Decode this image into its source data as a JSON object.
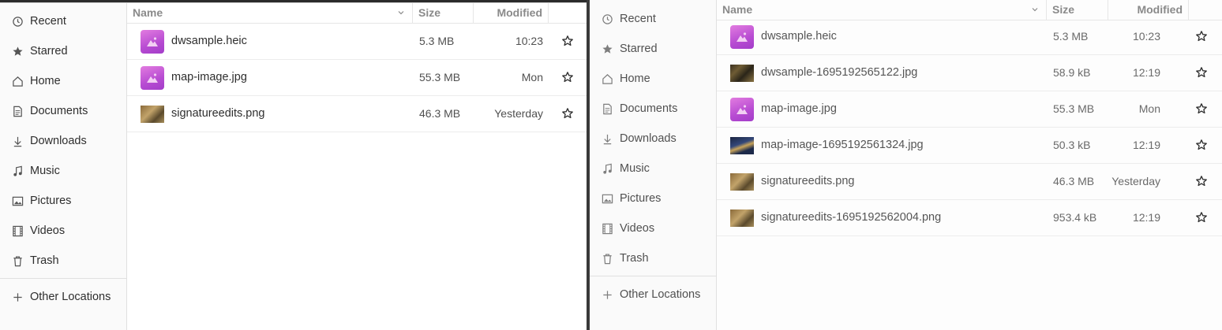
{
  "sidebar": {
    "items": [
      {
        "label": "Recent",
        "icon": "clock-icon"
      },
      {
        "label": "Starred",
        "icon": "star-filled-icon"
      },
      {
        "label": "Home",
        "icon": "home-icon"
      },
      {
        "label": "Documents",
        "icon": "document-icon"
      },
      {
        "label": "Downloads",
        "icon": "download-icon"
      },
      {
        "label": "Music",
        "icon": "music-icon"
      },
      {
        "label": "Pictures",
        "icon": "picture-icon"
      },
      {
        "label": "Videos",
        "icon": "video-icon"
      },
      {
        "label": "Trash",
        "icon": "trash-icon"
      }
    ],
    "other_locations": "Other Locations"
  },
  "columns": {
    "name": "Name",
    "size": "Size",
    "modified": "Modified"
  },
  "left_window": {
    "files": [
      {
        "name": "dwsample.heic",
        "size": "5.3 MB",
        "modified": "10:23",
        "thumb": "generic-image"
      },
      {
        "name": "map-image.jpg",
        "size": "55.3 MB",
        "modified": "Mon",
        "thumb": "generic-image"
      },
      {
        "name": "signatureedits.png",
        "size": "46.3 MB",
        "modified": "Yesterday",
        "thumb": "photo-brown"
      }
    ]
  },
  "right_window": {
    "files": [
      {
        "name": "dwsample.heic",
        "size": "5.3 MB",
        "modified": "10:23",
        "thumb": "generic-image"
      },
      {
        "name": "dwsample-1695192565122.jpg",
        "size": "58.9 kB",
        "modified": "12:19",
        "thumb": "photo-dark"
      },
      {
        "name": "map-image.jpg",
        "size": "55.3 MB",
        "modified": "Mon",
        "thumb": "generic-image"
      },
      {
        "name": "map-image-1695192561324.jpg",
        "size": "50.3 kB",
        "modified": "12:19",
        "thumb": "photo-blue"
      },
      {
        "name": "signatureedits.png",
        "size": "46.3 MB",
        "modified": "Yesterday",
        "thumb": "photo-brown"
      },
      {
        "name": "signatureedits-1695192562004.png",
        "size": "953.4 kB",
        "modified": "12:19",
        "thumb": "photo-brown"
      }
    ]
  },
  "colors": {
    "accent_thumb": "#c05ad6",
    "text": "#2e2e2e",
    "muted": "#8a8a8a"
  }
}
